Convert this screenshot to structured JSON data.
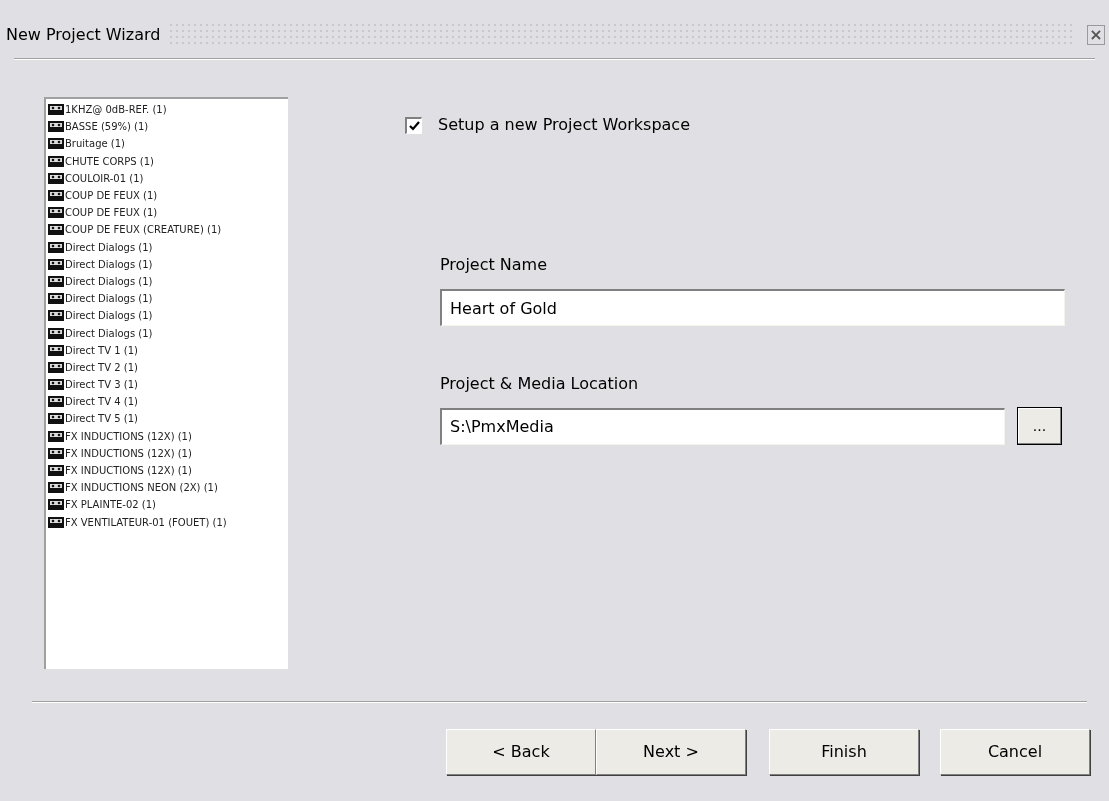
{
  "window": {
    "title": "New Project Wizard",
    "close": "×"
  },
  "list": {
    "items": [
      "1KHZ@ 0dB-REF. (1)",
      "BASSE (59%) (1)",
      "Bruitage (1)",
      "CHUTE CORPS (1)",
      "COULOIR-01 (1)",
      "COUP DE FEUX (1)",
      "COUP DE FEUX (1)",
      "COUP DE FEUX (CREATURE) (1)",
      "Direct Dialogs (1)",
      "Direct Dialogs (1)",
      "Direct Dialogs (1)",
      "Direct Dialogs (1)",
      "Direct Dialogs (1)",
      "Direct Dialogs (1)",
      "Direct TV 1 (1)",
      "Direct TV 2 (1)",
      "Direct TV 3 (1)",
      "Direct TV 4 (1)",
      "Direct TV 5 (1)",
      "FX INDUCTIONS (12X) (1)",
      "FX INDUCTIONS (12X) (1)",
      "FX INDUCTIONS (12X) (1)",
      "FX INDUCTIONS NEON (2X) (1)",
      "FX PLAINTE-02 (1)",
      "FX VENTILATEUR-01 (FOUET) (1)"
    ]
  },
  "workspace": {
    "label": "Setup a new Project Workspace",
    "checked": true
  },
  "project_name": {
    "label": "Project Name",
    "value": "Heart of Gold"
  },
  "location": {
    "label": "Project & Media Location",
    "value": "S:\\PmxMedia",
    "browse": "..."
  },
  "buttons": [
    "< Back",
    "Next >",
    "Finish",
    "Cancel"
  ]
}
